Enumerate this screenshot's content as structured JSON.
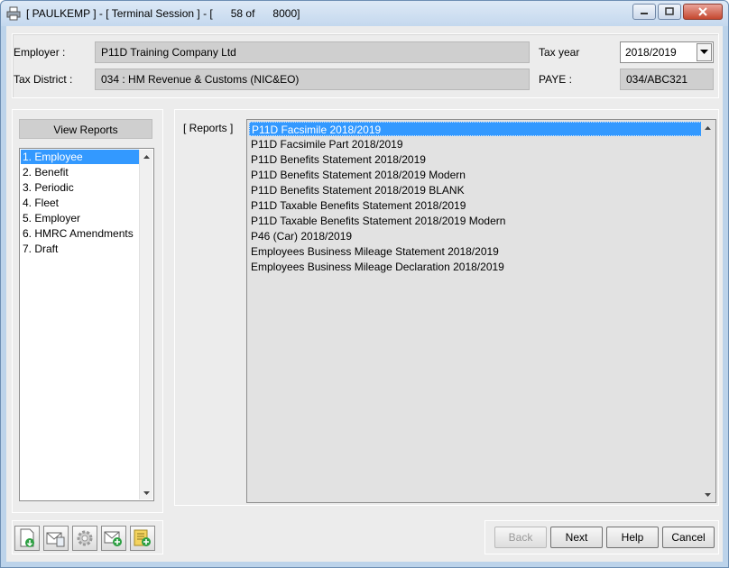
{
  "window": {
    "title": "[ PAULKEMP ] - [ Terminal Session ] - [      58 of      8000]"
  },
  "header": {
    "employer_label": "Employer :",
    "employer_value": "P11D Training Company Ltd",
    "tax_district_label": "Tax District :",
    "tax_district_value": "034 : HM Revenue & Customs (NIC&EO)",
    "tax_year_label": "Tax year",
    "tax_year_value": "2018/2019",
    "paye_label": "PAYE :",
    "paye_value": "034/ABC321"
  },
  "sidebar": {
    "view_reports_label": "View Reports",
    "items": [
      {
        "label": "1. Employee",
        "selected": true
      },
      {
        "label": "2. Benefit"
      },
      {
        "label": "3. Periodic"
      },
      {
        "label": "4. Fleet"
      },
      {
        "label": "5. Employer"
      },
      {
        "label": "6. HMRC Amendments"
      },
      {
        "label": "7. Draft"
      }
    ]
  },
  "reports": {
    "label": "[ Reports ]",
    "items": [
      {
        "label": "P11D Facsimile 2018/2019",
        "selected": true
      },
      {
        "label": "P11D Facsimile Part 2018/2019"
      },
      {
        "label": "P11D Benefits Statement 2018/2019"
      },
      {
        "label": "P11D Benefits Statement 2018/2019 Modern"
      },
      {
        "label": "P11D Benefits Statement 2018/2019 BLANK"
      },
      {
        "label": "P11D Taxable Benefits Statement 2018/2019"
      },
      {
        "label": "P11D Taxable Benefits Statement 2018/2019 Modern"
      },
      {
        "label": "P46 (Car) 2018/2019"
      },
      {
        "label": "Employees Business Mileage Statement 2018/2019"
      },
      {
        "label": "Employees Business Mileage Declaration 2018/2019"
      }
    ]
  },
  "toolbar": {
    "icons": [
      "document-download-icon",
      "mail-document-icon",
      "settings-gear-icon",
      "mail-add-icon",
      "notes-add-icon"
    ]
  },
  "buttons": {
    "back": "Back",
    "next": "Next",
    "help": "Help",
    "cancel": "Cancel"
  },
  "colors": {
    "selection": "#3399ff",
    "titlebar": "#c4d8ee"
  }
}
